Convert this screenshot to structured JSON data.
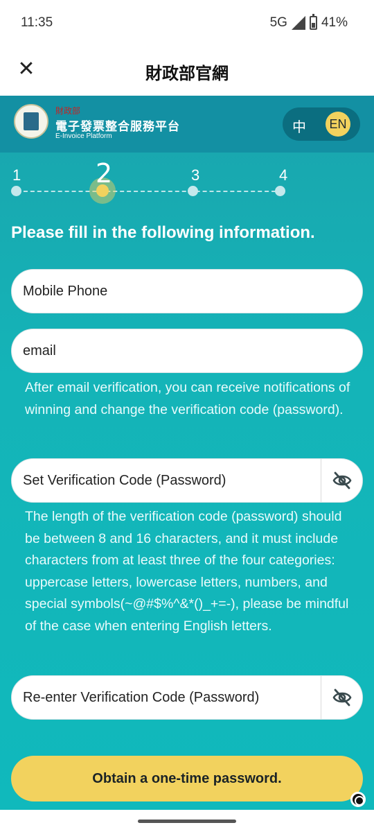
{
  "status_bar": {
    "time": "11:35",
    "network": "5G",
    "battery": "41%"
  },
  "app_bar": {
    "title": "財政部官網",
    "close_icon": "close-icon"
  },
  "header": {
    "logo_small": "財政部",
    "logo_main": "電子發票整合服務平台",
    "logo_sub": "E-Invoice Platform",
    "lang_zh": "中",
    "lang_en": "EN",
    "selected_language": "EN"
  },
  "stepper": {
    "steps": [
      "1",
      "2",
      "3",
      "4"
    ],
    "current_step": 2
  },
  "form": {
    "heading": "Please fill in the following information.",
    "mobile_placeholder": "Mobile Phone",
    "email_placeholder": "email",
    "email_helper": "After email verification, you can receive notifications of winning and change the verification code (password).",
    "password_placeholder": "Set Verification Code (Password)",
    "password_helper": "The length of the verification code (password) should be between 8 and 16 characters, and it must include characters from at least three of the four categories: uppercase letters, lowercase letters, numbers, and special symbols(~@#$%^&*()_+=-), please be mindful of the case when entering English letters.",
    "confirm_placeholder": "Re-enter Verification Code (Password)",
    "eye_icon": "eye-off-icon",
    "submit_label": "Obtain a one-time password."
  },
  "colors": {
    "accent_yellow": "#f2d25e",
    "teal": "#14b4b8",
    "header_band": "#1390a3"
  }
}
